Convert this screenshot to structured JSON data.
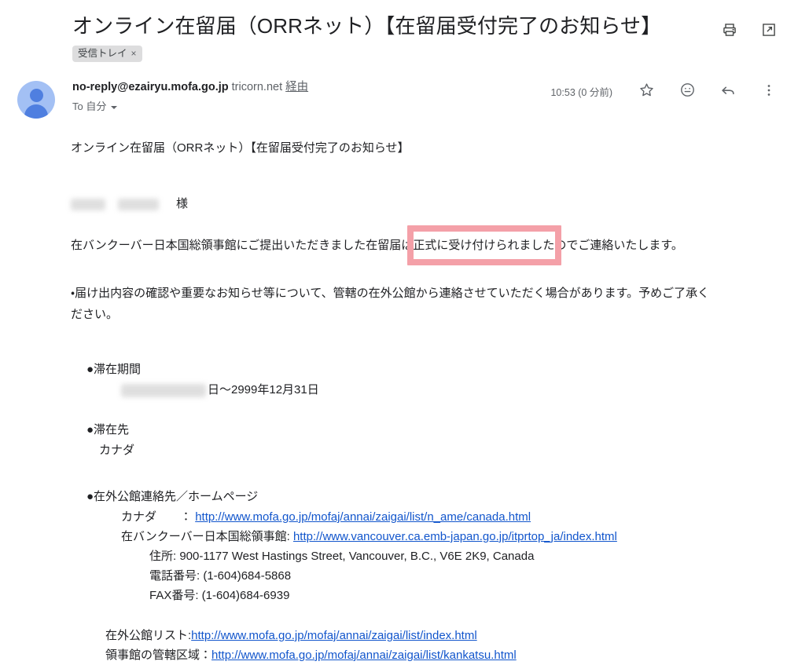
{
  "header": {
    "subject": "オンライン在留届（ORRネット）【在留届受付完了のお知らせ】",
    "label_chip": "受信トレイ",
    "label_chip_remove": "×",
    "print_icon": "printer-icon",
    "popout_icon": "open-in-new-window-icon"
  },
  "sender": {
    "email": "no-reply@ezairyu.mofa.go.jp",
    "via_domain": "tricorn.net",
    "via_word": "経由",
    "recipient_line": "To 自分",
    "timestamp": "10:53 (0 分前)",
    "star_icon": "star-icon",
    "emoji_icon": "emoji-smile-icon",
    "reply_icon": "reply-arrow-icon",
    "more_icon": "more-vertical-icon"
  },
  "body": {
    "repeated_subject": "オンライン在留届（ORRネット）【在留届受付完了のお知らせ】",
    "salutation_suffix": "様",
    "greeting_prefix": "在バンクーバー日本国総領事館にご提出いただきました在留届は",
    "greeting_highlight": "正式に受け付けられました",
    "greeting_suffix": "のでご連絡いたします。",
    "notice_line_1": "・届け出内容の確認や重要なお知らせ等について、管轄の在外公館から連絡させていただく場合があります。予めご了承く",
    "notice_line_2": "ださい。",
    "stay_period_head": "●滞在期間",
    "stay_period_value_suffix": "日〜2999年12月31日",
    "stay_place_head": "●滞在先",
    "stay_place_value": "カナダ",
    "contact_head": "●在外公館連絡先／ホームページ",
    "contacts": [
      {
        "label": "カナダ　　：",
        "url": "http://www.mofa.go.jp/mofaj/annai/zaigai/list/n_ame/canada.html"
      },
      {
        "label": "在バンクーバー日本国総領事館:",
        "url": "http://www.vancouver.ca.emb-japan.go.jp/itprtop_ja/index.html"
      }
    ],
    "address_lines": [
      "住所: 900-1177 West Hastings Street, Vancouver, B.C., V6E 2K9, Canada",
      "電話番号: (1-604)684-5868",
      "FAX番号: (1-604)684-6939"
    ],
    "lists": [
      {
        "label": "在外公館リスト:",
        "url": "http://www.mofa.go.jp/mofaj/annai/zaigai/list/index.html"
      },
      {
        "label": "領事館の管轄区域：",
        "url": "http://www.mofa.go.jp/mofaj/annai/zaigai/list/kankatsu.html"
      }
    ]
  },
  "colors": {
    "highlight_box": "#f4a0a8",
    "link": "#1155cc",
    "avatar_bg": "#a3c0f4",
    "avatar_fg": "#4f7fe0",
    "chip_bg": "#ddddde"
  }
}
